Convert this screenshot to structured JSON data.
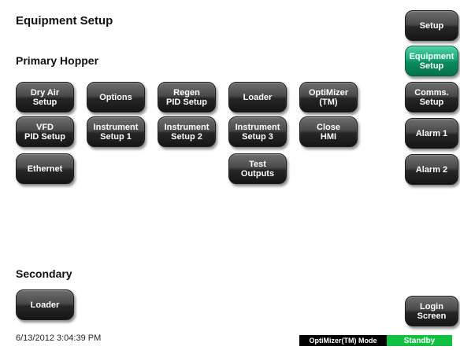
{
  "page": {
    "title": "Equipment Setup",
    "primary_heading": "Primary Hopper",
    "secondary_heading": "Secondary"
  },
  "primary_buttons": {
    "dry_air_setup": "Dry Air\nSetup",
    "options": "Options",
    "regen_pid_setup": "Regen\nPID Setup",
    "loader": "Loader",
    "optimizer_tm": "OptiMizer\n(TM)",
    "vfd_pid_setup": "VFD\nPID Setup",
    "instrument_setup_1": "Instrument\nSetup 1",
    "instrument_setup_2": "Instrument\nSetup 2",
    "instrument_setup_3": "Instrument\nSetup 3",
    "close_hmi": "Close\nHMI",
    "ethernet": "Ethernet",
    "test_outputs": "Test\nOutputs"
  },
  "secondary_buttons": {
    "loader": "Loader"
  },
  "side_nav": {
    "setup": "Setup",
    "equipment_setup": "Equipment\nSetup",
    "comms_setup": "Comms.\nSetup",
    "alarm_1": "Alarm 1",
    "alarm_2": "Alarm 2",
    "login_screen": "Login\nScreen"
  },
  "status_bar": {
    "timestamp": "6/13/2012 3:04:39 PM",
    "mode_label": "OptiMizer(TM) Mode",
    "state": "Standby",
    "state_color": "#10c040"
  },
  "colors": {
    "button": "#3a3a3a",
    "active_button": "#17a877"
  }
}
